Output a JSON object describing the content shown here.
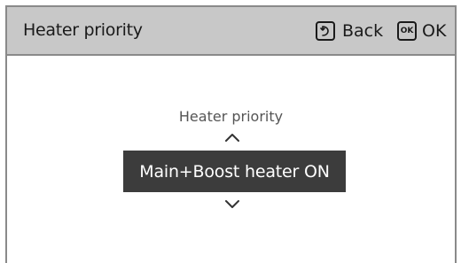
{
  "header": {
    "title": "Heater priority",
    "back_label": "Back",
    "ok_icon_text": "OK",
    "ok_label": "OK"
  },
  "selector": {
    "label": "Heater priority",
    "value": "Main+Boost heater ON"
  },
  "icons": {
    "back": "back-arrow-icon",
    "ok": "ok-icon",
    "up": "chevron-up-icon",
    "down": "chevron-down-icon"
  },
  "colors": {
    "header_bg": "#c8c8c8",
    "value_bg": "#3c3c3c",
    "value_text": "#ffffff"
  }
}
